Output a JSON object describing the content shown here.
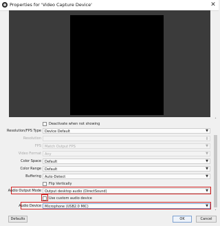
{
  "window": {
    "title": "Properties for 'Video Capture Device'",
    "close_glyph": "✕",
    "icon": "obs-app-icon"
  },
  "properties": {
    "deactivate_label": "Deactivate when not showing",
    "resolution_fps_type": {
      "label": "Resolution/FPS Type",
      "value": "Device Default"
    },
    "resolution": {
      "label": "Resolution",
      "value": ""
    },
    "fps": {
      "label": "FPS",
      "value": "Match Output FPS"
    },
    "video_format": {
      "label": "Video Format",
      "value": "Any"
    },
    "color_space": {
      "label": "Color Space",
      "value": "Default"
    },
    "color_range": {
      "label": "Color Range",
      "value": "Default"
    },
    "buffering": {
      "label": "Buffering",
      "value": "Auto-Detect"
    },
    "flip_label": "Flip Vertically",
    "audio_output_mode": {
      "label": "Audio Output Mode",
      "value": "Output desktop audio (DirectSound)"
    },
    "custom_audio_label": "Use custom audio device",
    "audio_device": {
      "label": "Audio Device",
      "value": "Microphone (USB2.0 MIC)"
    }
  },
  "buttons": {
    "defaults": "Defaults",
    "ok": "OK",
    "cancel": "Cancel"
  },
  "dropdown_arrow": "▼",
  "scroll": {
    "up": "˄",
    "down": "˅"
  },
  "highlight_color": "#d11f1f"
}
